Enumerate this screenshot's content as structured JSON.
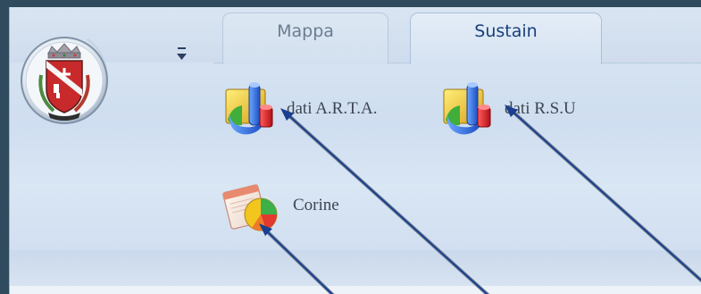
{
  "tabs": [
    {
      "label": "Mappa",
      "active": false
    },
    {
      "label": "Sustain",
      "active": true
    }
  ],
  "buttons": {
    "arta": {
      "label": "dati A.R.T.A.",
      "icon": "chart-icon"
    },
    "rsu": {
      "label": "dati R.S.U",
      "icon": "chart-icon"
    },
    "corine": {
      "label": "Corine",
      "icon": "pie-chart-report-icon"
    }
  },
  "colors": {
    "frame": "#2f4b5d",
    "active_tab_text": "#17407c",
    "inactive_tab_text": "#6b7d90",
    "arrow": "#143c8c"
  }
}
